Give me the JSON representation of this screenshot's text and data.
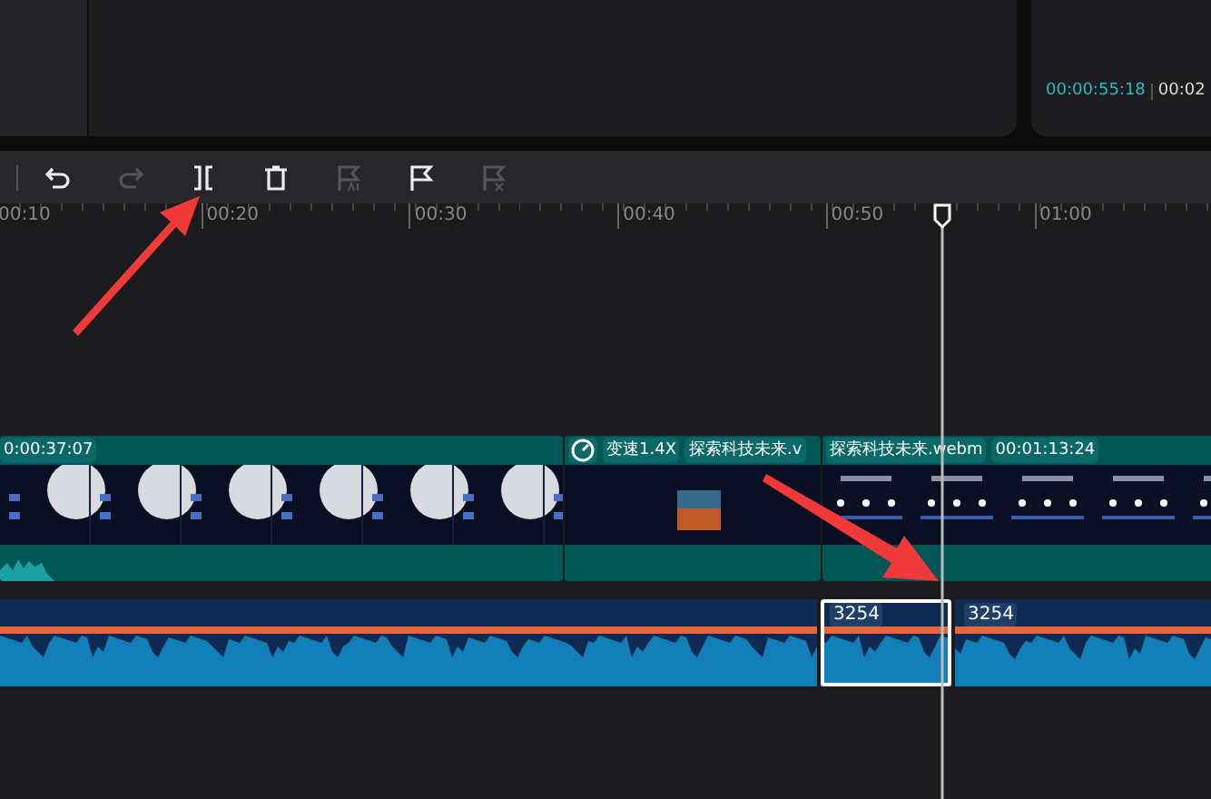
{
  "preview": {
    "timecode_current": "00:00:55:18",
    "timecode_total": "00:02"
  },
  "toolbar": [
    {
      "kind": "undo",
      "disabled": false
    },
    {
      "kind": "redo",
      "disabled": true
    },
    {
      "kind": "split",
      "disabled": false
    },
    {
      "kind": "delete",
      "disabled": false
    },
    {
      "kind": "flag-ai",
      "disabled": true
    },
    {
      "kind": "flag",
      "disabled": false
    },
    {
      "kind": "flag-remove",
      "disabled": true
    }
  ],
  "ruler": {
    "ticks": [
      "00:10",
      "00:20",
      "00:30",
      "00:40",
      "00:50",
      "01:00"
    ]
  },
  "video_track": {
    "clips": [
      {
        "kind": "moon",
        "badges": [
          {
            "kind": "text",
            "text": "0:00:37:07"
          }
        ]
      },
      {
        "kind": "desert",
        "badges": [
          {
            "kind": "speed-icon"
          },
          {
            "kind": "text",
            "text": "变速1.4X"
          },
          {
            "kind": "text",
            "text": "探索科技未来.v"
          }
        ]
      },
      {
        "kind": "slides",
        "badges": [
          {
            "kind": "text",
            "text": "探索科技未来.webm"
          },
          {
            "kind": "text",
            "text": "00:01:13:24"
          }
        ]
      }
    ]
  },
  "audio_track": {
    "segments": [
      {
        "selected": false
      },
      {
        "label": "3254",
        "selected": true
      },
      {
        "label": "3254",
        "selected": false
      }
    ]
  }
}
